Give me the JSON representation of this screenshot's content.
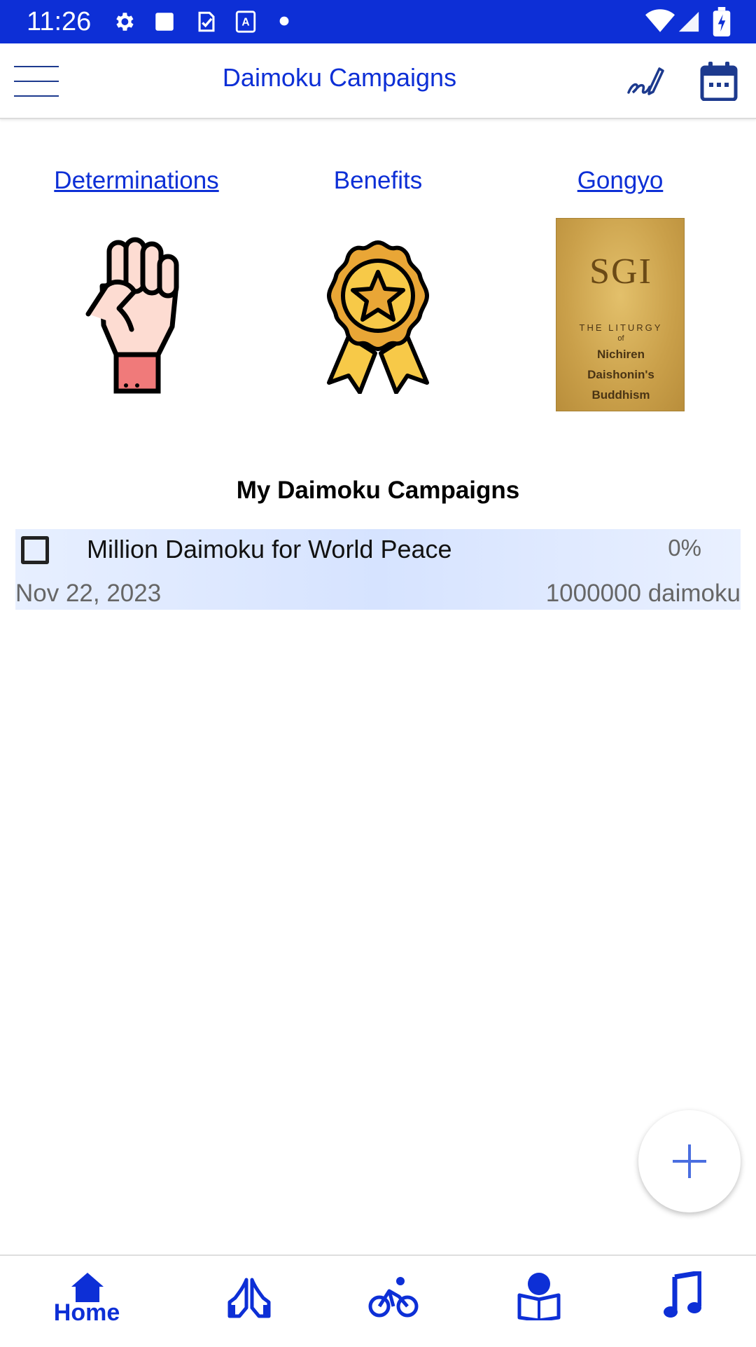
{
  "status_bar": {
    "time": "11:26",
    "icons": [
      "settings-icon",
      "square-icon",
      "task-icon",
      "text-icon",
      "dot-icon",
      "wifi-icon",
      "signal-icon",
      "battery-icon"
    ]
  },
  "app_bar": {
    "title": "Daimoku Campaigns",
    "menu_icon": "hamburger-icon",
    "actions": [
      "signature-icon",
      "calendar-icon"
    ]
  },
  "quick_links": [
    {
      "label": "Determinations",
      "icon": "raised-fist-icon",
      "underlined": true
    },
    {
      "label": "Benefits",
      "icon": "award-ribbon-icon",
      "underlined": false
    },
    {
      "label": "Gongyo",
      "icon": "liturgy-book-image",
      "underlined": true
    }
  ],
  "gongyo_book": {
    "logo": "SGI",
    "line1": "THE LITURGY",
    "line2": "of",
    "line3": "Nichiren",
    "line4": "Daishonin's",
    "line5": "Buddhism"
  },
  "section": {
    "title": "My Daimoku Campaigns"
  },
  "campaigns": [
    {
      "name": "Million Daimoku for World Peace",
      "percent": "0%",
      "date": "Nov 22, 2023",
      "goal": "1000000 daimoku",
      "checked": false
    }
  ],
  "fab": {
    "icon": "plus-icon"
  },
  "bottom_nav": {
    "active": "Home",
    "items": [
      {
        "label": "Home",
        "icon": "home-icon"
      },
      {
        "label": "",
        "icon": "praying-hands-icon"
      },
      {
        "label": "",
        "icon": "cyclist-icon"
      },
      {
        "label": "",
        "icon": "reading-icon"
      },
      {
        "label": "",
        "icon": "music-note-icon"
      }
    ]
  },
  "colors": {
    "primary": "#0d2fd6",
    "status_bar": "#0d2fd6",
    "row_highlight": "#dde7ff",
    "muted_text": "#666666"
  }
}
